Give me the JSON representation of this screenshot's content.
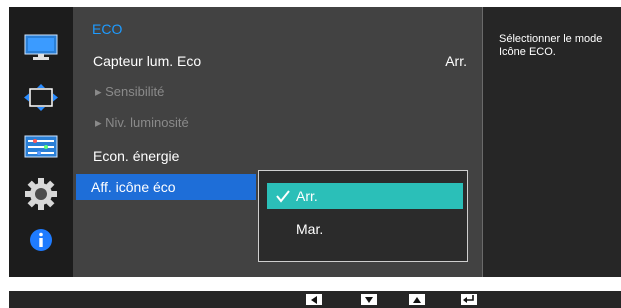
{
  "menu": {
    "title": "ECO",
    "items": [
      {
        "label": "Capteur lum. Eco",
        "value": "Arr."
      },
      {
        "label": "▸ Sensibilité"
      },
      {
        "label": "▸ Niv. luminosité"
      },
      {
        "label": "Econ. énergie"
      },
      {
        "label": "Aff. icône éco"
      }
    ]
  },
  "dropdown": {
    "options": [
      "Arr.",
      "Mar."
    ],
    "selected": "Arr."
  },
  "info": {
    "text": "Sélectionner le mode\nIcône ECO."
  },
  "sidebar": {
    "icons": [
      "monitor-icon",
      "size-position-icon",
      "color-settings-icon",
      "gear-icon",
      "info-icon"
    ]
  },
  "nav_keys": [
    "left-arrow-icon",
    "down-arrow-icon",
    "up-arrow-icon",
    "enter-icon"
  ],
  "colors": {
    "accent_blue": "#1e9bff",
    "selected_row": "#1e6ed8",
    "active_option": "#2bbfb8"
  }
}
